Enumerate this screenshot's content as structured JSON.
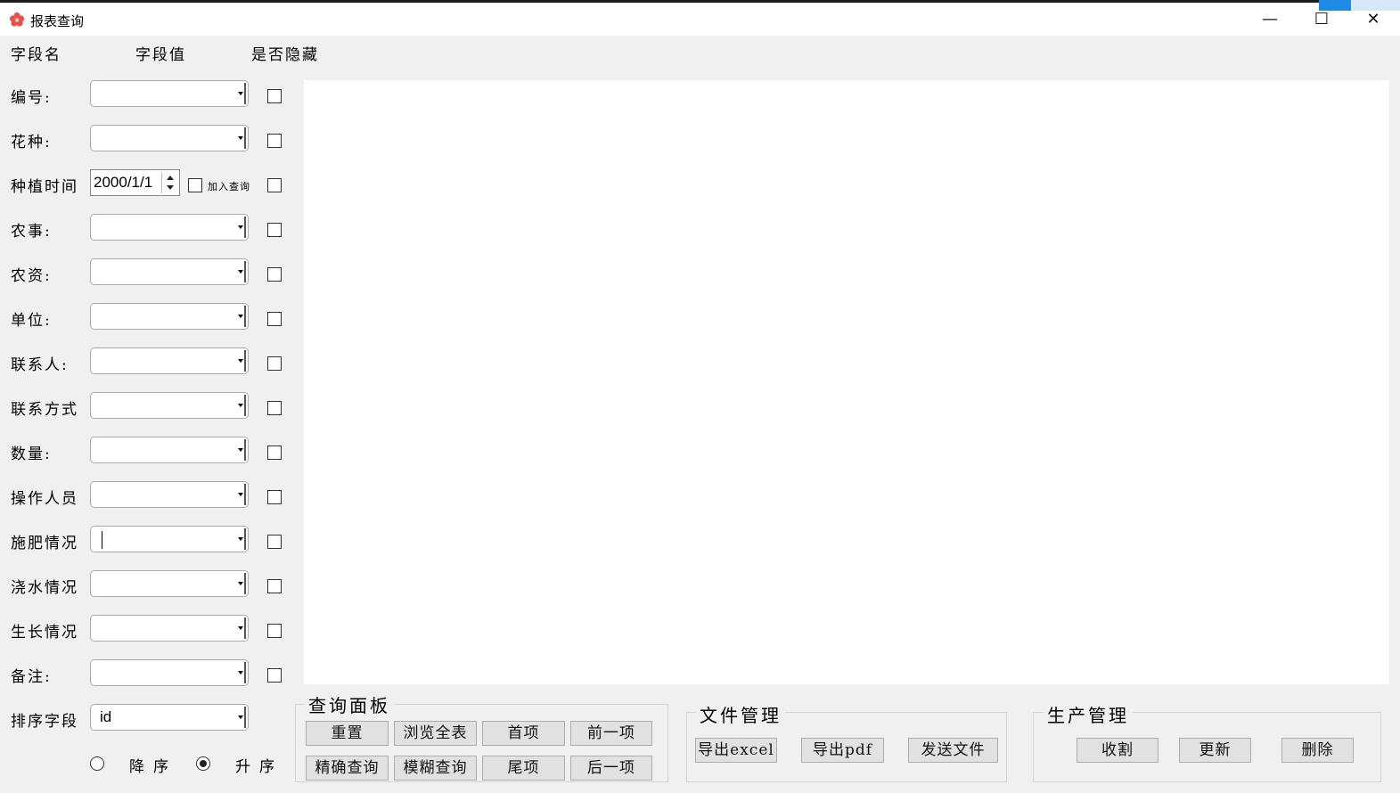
{
  "window": {
    "title": "报表查询",
    "minimize_glyph": "—",
    "maximize_glyph": "☐",
    "close_glyph": "✕"
  },
  "headers": {
    "field_name": "字段名",
    "field_value": "字段值",
    "is_hidden": "是否隐藏"
  },
  "fields": {
    "id": {
      "label": "编号:",
      "value": ""
    },
    "variety": {
      "label": "花种:",
      "value": ""
    },
    "planting_time": {
      "label": "种植时间",
      "value": "2000/1/1",
      "join_query_label": "加入查询"
    },
    "farm_work": {
      "label": "农事:",
      "value": ""
    },
    "farm_supplies": {
      "label": "农资:",
      "value": ""
    },
    "unit": {
      "label": "单位:",
      "value": ""
    },
    "contact": {
      "label": "联系人:",
      "value": ""
    },
    "contact_method": {
      "label": "联系方式",
      "value": ""
    },
    "quantity": {
      "label": "数量:",
      "value": ""
    },
    "operator": {
      "label": "操作人员",
      "value": ""
    },
    "fertilizing": {
      "label": "施肥情况",
      "value": ""
    },
    "watering": {
      "label": "浇水情况",
      "value": ""
    },
    "growth": {
      "label": "生长情况",
      "value": ""
    },
    "remarks": {
      "label": "备注:",
      "value": ""
    }
  },
  "sort": {
    "label": "排序字段",
    "value": "id",
    "desc_label": "降序",
    "asc_label": "升序",
    "selected": "asc"
  },
  "query_panel": {
    "title": "查询面板",
    "reset": "重置",
    "browse_all": "浏览全表",
    "first": "首项",
    "prev": "前一项",
    "exact_query": "精确查询",
    "fuzzy_query": "模糊查询",
    "last": "尾项",
    "next": "后一项"
  },
  "file_mgmt": {
    "title": "文件管理",
    "export_excel": "导出excel",
    "export_pdf": "导出pdf",
    "send_file": "发送文件"
  },
  "production_mgmt": {
    "title": "生产管理",
    "harvest": "收割",
    "update": "更新",
    "delete": "删除"
  },
  "colors": {
    "title_bar": "#ffffff",
    "window_bg": "#f0f0f0",
    "button_bg": "#e1e1e1",
    "app_icon": "#e8504a"
  }
}
